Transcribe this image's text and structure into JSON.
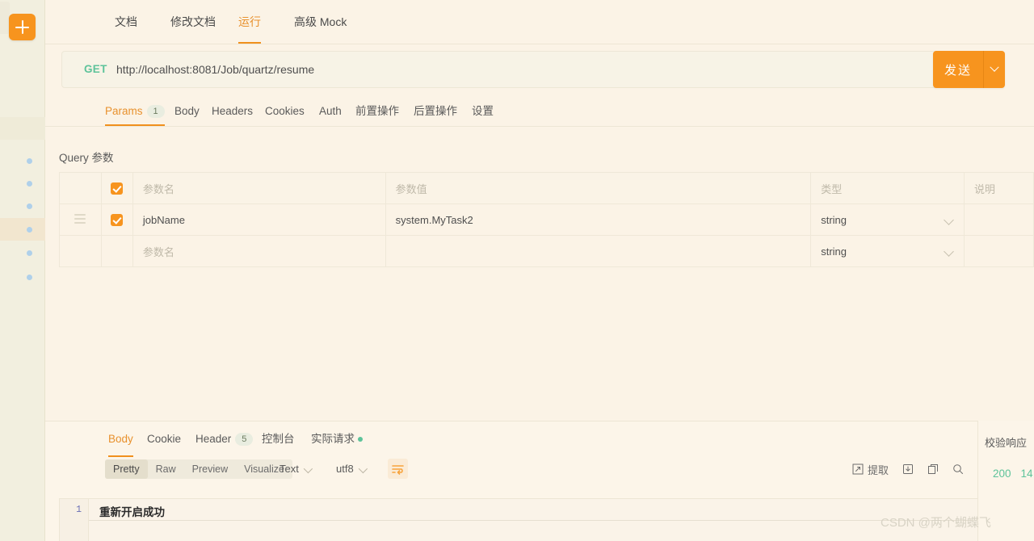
{
  "sidebar": {
    "add_button_label": "+",
    "tree_items": [
      {
        "label": "",
        "selected": false
      },
      {
        "label": "",
        "selected": false
      },
      {
        "label": "",
        "selected": false
      },
      {
        "label": "",
        "selected": true
      },
      {
        "label": "",
        "selected": false
      },
      {
        "label": "",
        "selected": false
      }
    ]
  },
  "top_tabs": [
    {
      "label": "文档",
      "active": false
    },
    {
      "label": "修改文档",
      "active": false
    },
    {
      "label": "运行",
      "active": true
    },
    {
      "label": "高级 Mock",
      "active": false
    }
  ],
  "request": {
    "method": "GET",
    "url": "http://localhost:8081/Job/quartz/resume",
    "send_label": "发送",
    "send_dropdown_icon": "chevron-down-icon"
  },
  "sub_tabs": [
    {
      "label": "Params",
      "badge": "1",
      "active": true
    },
    {
      "label": "Body",
      "badge": "",
      "active": false
    },
    {
      "label": "Headers",
      "badge": "",
      "active": false
    },
    {
      "label": "Cookies",
      "badge": "",
      "active": false
    },
    {
      "label": "Auth",
      "badge": "",
      "active": false
    },
    {
      "label": "前置操作",
      "badge": "",
      "active": false
    },
    {
      "label": "后置操作",
      "badge": "",
      "active": false
    },
    {
      "label": "设置",
      "badge": "",
      "active": false
    }
  ],
  "params": {
    "section_title": "Query 参数",
    "columns": [
      "参数名",
      "参数值",
      "类型",
      "说明"
    ],
    "rows": [
      {
        "checked": true,
        "name": "jobName",
        "value": "system.MyTask2",
        "type": "string",
        "desc": "",
        "placeholder": false
      },
      {
        "checked": false,
        "name": "参数名",
        "value": "",
        "type": "string",
        "desc": "",
        "placeholder": true
      }
    ],
    "header_checked": true
  },
  "response": {
    "tabs": [
      {
        "label": "Body",
        "badge": "",
        "dot": false,
        "active": true
      },
      {
        "label": "Cookie",
        "badge": "",
        "dot": false,
        "active": false
      },
      {
        "label": "Header",
        "badge": "5",
        "dot": false,
        "active": false
      },
      {
        "label": "控制台",
        "badge": "",
        "dot": false,
        "active": false
      },
      {
        "label": "实际请求",
        "badge": "",
        "dot": true,
        "active": false
      }
    ],
    "format_modes": [
      {
        "label": "Pretty",
        "selected": true
      },
      {
        "label": "Raw",
        "selected": false
      },
      {
        "label": "Preview",
        "selected": false
      },
      {
        "label": "Visualize",
        "selected": false
      }
    ],
    "type_select": "Text",
    "encoding_select": "utf8",
    "wrap_icon": "word-wrap-icon",
    "tools": [
      {
        "label": "提取",
        "icon": "extract-icon"
      },
      {
        "label": "",
        "icon": "download-icon"
      },
      {
        "label": "",
        "icon": "copy-icon"
      },
      {
        "label": "",
        "icon": "search-icon"
      }
    ],
    "body": {
      "line_number": "1",
      "content": "重新开启成功"
    }
  },
  "validate_panel": {
    "title": "校验响应",
    "status_code": "200",
    "time_value": "14"
  },
  "watermark": "CSDN @两个蝴蝶飞",
  "colors": {
    "accent_orange": "#F7941E",
    "active_tab": "#E8912D",
    "method_green": "#5DC39A",
    "page_bg": "#FBF3E6",
    "sidebar_bg": "#F2EFDF"
  }
}
